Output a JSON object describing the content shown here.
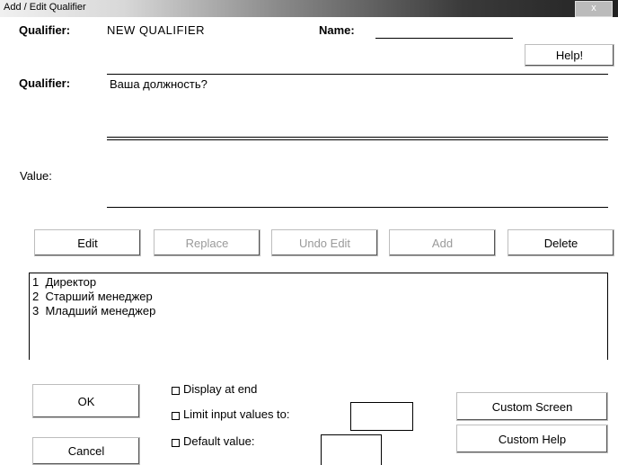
{
  "window": {
    "title": "Add / Edit Qualifier",
    "close_label": "x"
  },
  "header": {
    "qualifier_label": "Qualifier:",
    "qualifier_value": "NEW QUALIFIER",
    "name_label": "Name:",
    "name_value": "",
    "help_label": "Help!"
  },
  "qualifier_text": {
    "label": "Qualifier:",
    "value": "Ваша должность?"
  },
  "value_field": {
    "label": "Value:",
    "value": ""
  },
  "edit_buttons": {
    "edit": "Edit",
    "replace": "Replace",
    "undo_edit": "Undo Edit",
    "add": "Add",
    "delete": "Delete"
  },
  "values_list": [
    {
      "number": "1",
      "text": "Директор"
    },
    {
      "number": "2",
      "text": "Старший менеджер"
    },
    {
      "number": "3",
      "text": "Младший менеджер"
    }
  ],
  "bottom": {
    "ok": "OK",
    "cancel": "Cancel",
    "display_at_end": "Display at end",
    "limit_input": "Limit input values to:",
    "limit_value": "",
    "default_value": "Default value:",
    "default_text": "",
    "custom_screen": "Custom Screen",
    "custom_help": "Custom Help"
  }
}
